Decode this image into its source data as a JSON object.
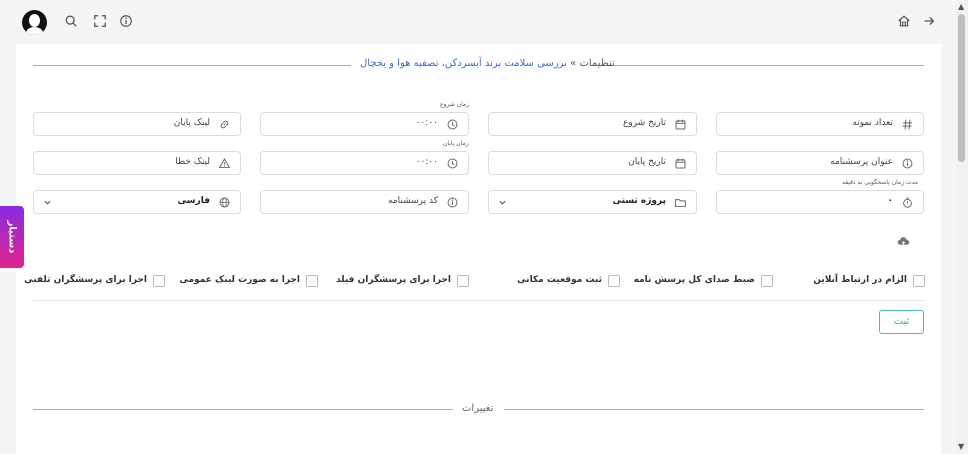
{
  "topbar": {
    "icons": [
      "avatar",
      "search-icon",
      "fullscreen-icon",
      "info-icon",
      "home-icon",
      "arrow-right-icon"
    ]
  },
  "breadcrumb": {
    "link": "بررسی سلامت برند آبسردکن، تصفیه هوا و یخچال",
    "separator": "»",
    "current": "تنظیمات"
  },
  "form": {
    "sample_count": "تعداد نمونه",
    "start_date": "تاریخ شروع",
    "start_time_label": "زمان شروع",
    "start_time_value": "۰۰:۰۰",
    "end_link": "لینک پایان",
    "questionnaire_title": "عنوان پرسشنامه",
    "end_date": "تاریخ پایان",
    "end_time_label": "زمان پایان",
    "end_time_value": "۰۰:۰۰",
    "error_link": "لینک خطا",
    "response_time_label": "مدت زمان پاسخگویی به دقیقه",
    "response_time_value": "۰",
    "project": "پروژه تستی",
    "questionnaire_code": "کد پرسشنامه",
    "language": "فارسی"
  },
  "checkboxes": [
    "الزام در ارتباط آنلاین",
    "ضبط صدای کل پرسش نامه",
    "ثبت موقعیت مکانی",
    "اجرا برای پرسشگران فیلد",
    "اجرا به صورت لینک عمومی",
    "اجرا برای پرسشگران تلفنی"
  ],
  "submit_label": "ثبت",
  "assistant_label": "دستیار",
  "changes_title": "تغییرات"
}
